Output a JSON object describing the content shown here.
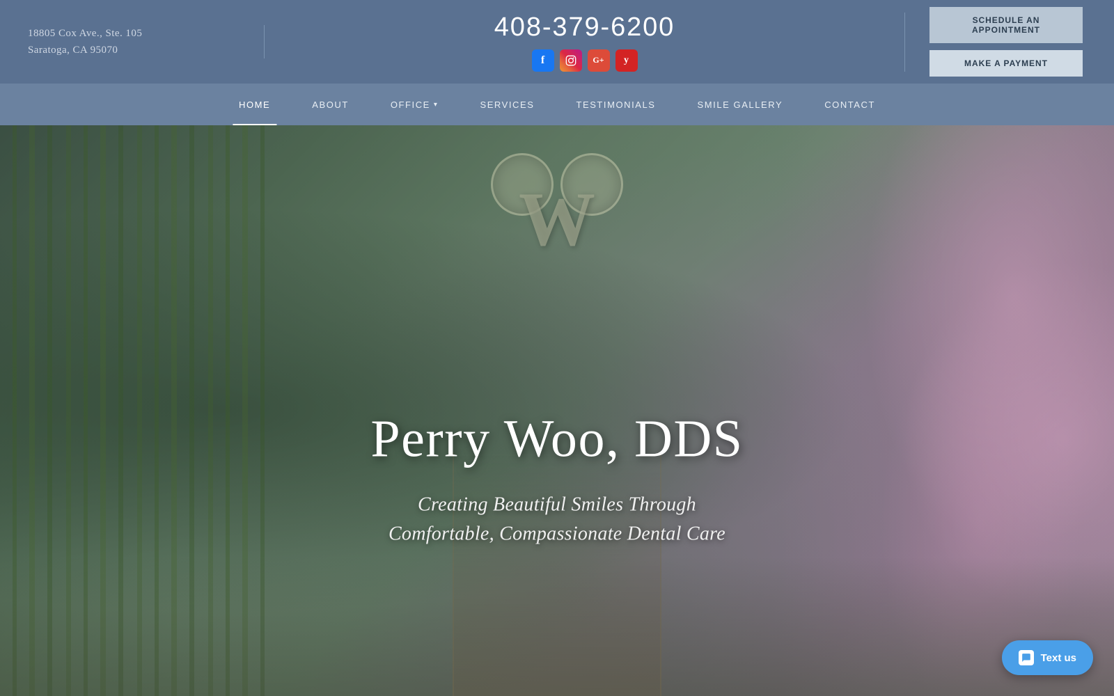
{
  "header": {
    "address_line1": "18805 Cox Ave., Ste. 105",
    "address_line2": "Saratoga, CA 95070",
    "phone": "408-379-6200",
    "schedule_btn": "SCHEDULE AN APPOINTMENT",
    "payment_btn": "MAKE A PAYMENT"
  },
  "social": {
    "facebook_label": "f",
    "instagram_label": "📷",
    "google_label": "G+",
    "yelp_label": "y"
  },
  "nav": {
    "items": [
      {
        "label": "HOME",
        "active": true,
        "has_dropdown": false
      },
      {
        "label": "ABOUT",
        "active": false,
        "has_dropdown": false
      },
      {
        "label": "OFFICE",
        "active": false,
        "has_dropdown": true
      },
      {
        "label": "SERVICES",
        "active": false,
        "has_dropdown": false
      },
      {
        "label": "TESTIMONIALS",
        "active": false,
        "has_dropdown": false
      },
      {
        "label": "SMILE GALLERY",
        "active": false,
        "has_dropdown": false
      },
      {
        "label": "CONTACT",
        "active": false,
        "has_dropdown": false
      }
    ]
  },
  "hero": {
    "name": "Perry Woo, DDS",
    "tagline_line1": "Creating Beautiful Smiles Through",
    "tagline_line2": "Comfortable, Compassionate Dental Care"
  },
  "text_us": {
    "label": "Text us"
  }
}
